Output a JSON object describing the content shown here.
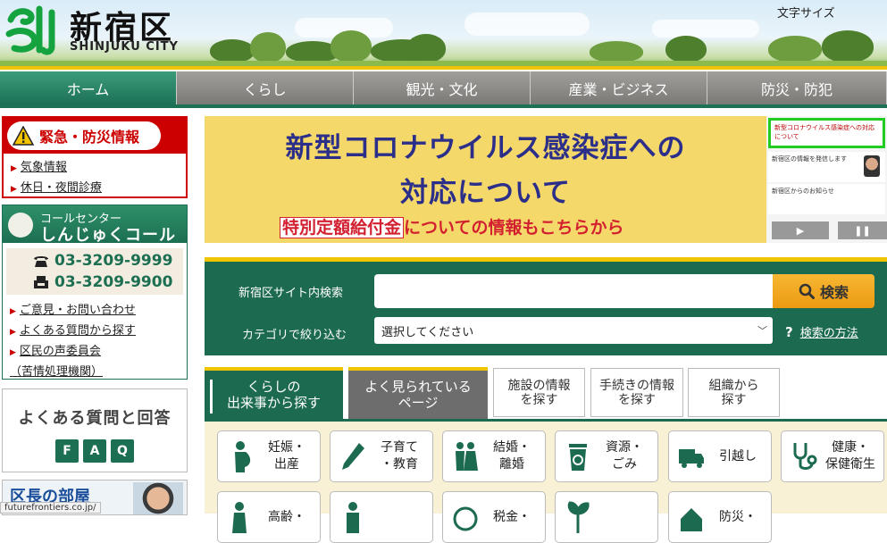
{
  "header": {
    "logo_title": "新宿区",
    "logo_sub": "SHINJUKU CITY",
    "font_size_label": "文字サイズ"
  },
  "nav": [
    {
      "label": "ホーム",
      "active": true
    },
    {
      "label": "くらし"
    },
    {
      "label": "観光・文化"
    },
    {
      "label": "産業・ビジネス"
    },
    {
      "label": "防災・防犯"
    }
  ],
  "emergency": {
    "title": "緊急・防災情報",
    "links": [
      "気象情報",
      "休日・夜間診療"
    ]
  },
  "callcenter": {
    "line1": "コールセンター",
    "line2": "しんじゅくコール",
    "phone": "03-3209-9999",
    "fax": "03-3209-9900",
    "links": [
      "ご意見・お問い合わせ",
      "よくある質問から探す",
      "区民の声委員会",
      "（苦情処理機関）"
    ]
  },
  "faq": {
    "title": "よくある質問と回答",
    "badges": [
      "F",
      "A",
      "Q"
    ]
  },
  "mayor": {
    "title": "区長の部屋"
  },
  "banner": {
    "line1": "新型コロナウイルス感染症への",
    "line2": "対応について",
    "line3_highlight": "特別定額給付金",
    "line3_rest": "についての情報もこちらから"
  },
  "thumbs": {
    "items": [
      "新型コロナウイルス感染症への対応について",
      "新宿区の情報を発信します",
      "新宿区からのお知らせ"
    ],
    "play_label": "▶",
    "pause_label": "❚❚"
  },
  "search": {
    "label": "新宿区サイト内検索",
    "value": "",
    "button": "検索",
    "category_label": "カテゴリで絞り込む",
    "category_selected": "選択してください",
    "help_q": "?",
    "help_link": "検索の方法"
  },
  "tabs": [
    {
      "line1": "くらしの",
      "line2": "出来事から探す"
    },
    {
      "line1": "よく見られている",
      "line2": "ページ"
    },
    {
      "line1": "施設の情報",
      "line2": "を探す"
    },
    {
      "line1": "手続きの情報",
      "line2": "を探す"
    },
    {
      "line1": "組織から",
      "line2": "探す"
    }
  ],
  "categories": [
    {
      "line1": "妊娠・",
      "line2": "出産",
      "icon": "pregnancy-icon"
    },
    {
      "line1": "子育て",
      "line2": "・教育",
      "icon": "pencil-icon"
    },
    {
      "line1": "結婚・",
      "line2": "離婚",
      "icon": "couple-icon"
    },
    {
      "line1": "資源・",
      "line2": "ごみ",
      "icon": "recycle-bin-icon"
    },
    {
      "line1": "引越し",
      "line2": "",
      "icon": "truck-icon"
    },
    {
      "line1": "健康・",
      "line2": "保健衛生",
      "icon": "stethoscope-icon"
    },
    {
      "line1": "高齢・",
      "line2": "",
      "icon": "elderly-icon"
    },
    {
      "line1": "",
      "line2": "",
      "icon": "person-icon"
    },
    {
      "line1": "税金・",
      "line2": "",
      "icon": "tax-icon"
    },
    {
      "line1": "",
      "line2": "",
      "icon": "plant-icon"
    },
    {
      "line1": "防災・",
      "line2": "",
      "icon": "disaster-icon"
    }
  ],
  "statusbar": "futurefrontiers.co.jp/"
}
